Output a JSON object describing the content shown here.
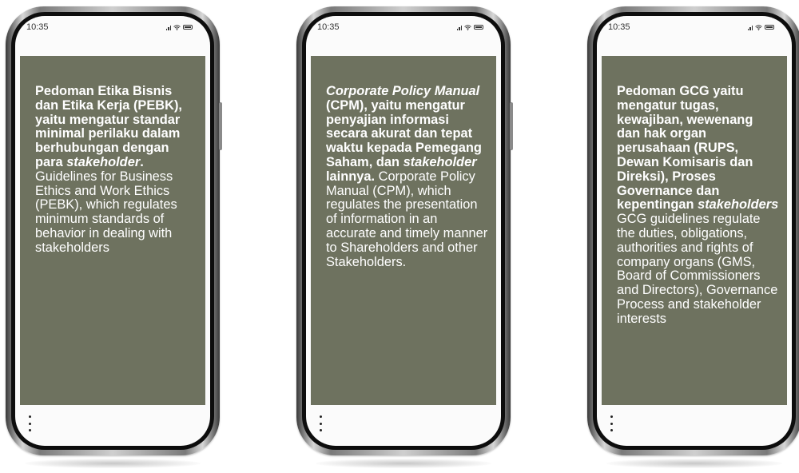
{
  "phones": [
    {
      "status_time": "10:35",
      "text_bold_1": "Pedoman Etika Bisnis dan Etika Kerja (PEBK), yaitu mengatur standar minimal perilaku dalam berhubungan dengan para ",
      "text_bold_italic": "stakeholder",
      "text_bold_2": ".",
      "text_regular": " Guidelines for Business Ethics and Work Ethics (PEBK), which regulates minimum standards of behavior in dealing with stakeholders"
    },
    {
      "status_time": "10:35",
      "text_bold_italic_1": "Corporate Policy Manual",
      "text_bold_1": " (CPM), yaitu mengatur penyajian informasi secara akurat dan tepat waktu  kepada Pemegang Saham, dan ",
      "text_bold_italic_2": "stakeholder",
      "text_bold_2": " lainnya.",
      "text_regular": " Corporate Policy Manual (CPM), which regulates the presentation of information in an accurate and timely manner to Shareholders and other Stakeholders."
    },
    {
      "status_time": "10:35",
      "text_bold_1": "Pedoman GCG yaitu mengatur tugas, kewajiban, wewenang dan hak organ perusahaan (RUPS, Dewan Komisaris dan Direksi), Proses Governance dan kepentingan ",
      "text_bold_italic": "stakeholders",
      "text_regular": " GCG guidelines regulate the duties, obligations, authorities and rights of company organs (GMS, Board of Commissioners and Directors), Governance Process and stakeholder interests"
    }
  ],
  "colors": {
    "panel": "#6e725f",
    "text": "#ffffff",
    "screen": "#fbfbfb"
  },
  "icons": [
    "signal-icon",
    "wifi-icon",
    "battery-icon",
    "more-vertical-icon"
  ]
}
